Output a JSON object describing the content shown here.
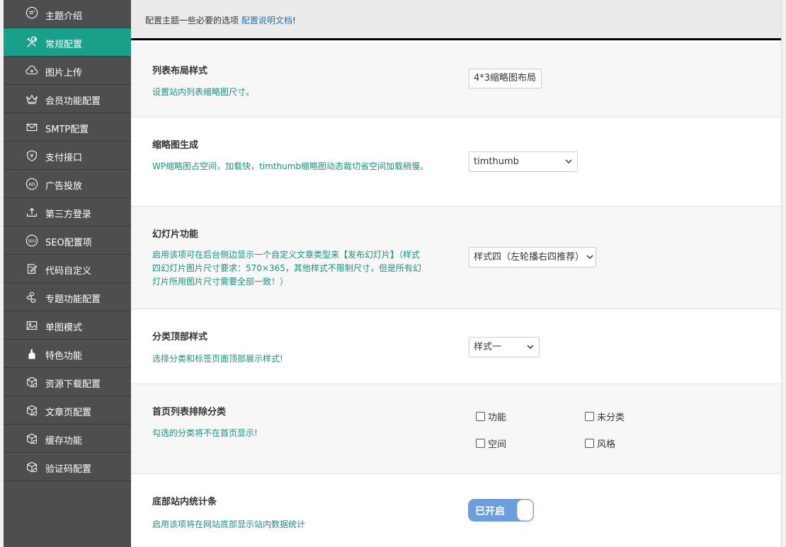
{
  "sidebar": {
    "items": [
      {
        "label": "主题介绍",
        "icon": "speech-bubble-icon"
      },
      {
        "label": "常规配置",
        "icon": "tools-icon",
        "active": true
      },
      {
        "label": "图片上传",
        "icon": "cloud-upload-icon"
      },
      {
        "label": "会员功能配置",
        "icon": "crown-icon"
      },
      {
        "label": "SMTP配置",
        "icon": "mail-icon"
      },
      {
        "label": "支付接口",
        "icon": "yen-shield-icon"
      },
      {
        "label": "广告投放",
        "icon": "ad-icon"
      },
      {
        "label": "第三方登录",
        "icon": "login-upload-icon"
      },
      {
        "label": "SEO配置项",
        "icon": "seo-icon"
      },
      {
        "label": "代码自定义",
        "icon": "code-edit-icon"
      },
      {
        "label": "专题功能配置",
        "icon": "topic-icon"
      },
      {
        "label": "单图模式",
        "icon": "image-icon"
      },
      {
        "label": "特色功能",
        "icon": "thumb-icon"
      },
      {
        "label": "资源下载配置",
        "icon": "box-gear-icon"
      },
      {
        "label": "文章页配置",
        "icon": "box-gear-icon"
      },
      {
        "label": "缓存功能",
        "icon": "box-gear-icon"
      },
      {
        "label": "验证码配置",
        "icon": "box-gear-icon"
      }
    ]
  },
  "header": {
    "text": "配置主题一些必要的选项",
    "link": "配置说明文档",
    "suffix": "!"
  },
  "sections": {
    "list_layout": {
      "title": "列表布局样式",
      "desc": "设置站内列表缩略图尺寸。",
      "value": "4*3缩略图布局"
    },
    "thumb_gen": {
      "title": "缩略图生成",
      "desc": "WP缩略图占空间，加载快，timthumb缩略图动态裁切省空间加载稍慢。",
      "value": "timthumb"
    },
    "slides": {
      "title": "幻灯片功能",
      "desc": "启用该项可在后台侧边显示一个自定义文章类型来【发布幻灯片】（样式四幻灯片图片尺寸要求：570×365，其他样式不限制尺寸，但是所有幻灯片所用图片尺寸需要全部一致！）",
      "value": "样式四（左轮播右四推荐）"
    },
    "cat_header": {
      "title": "分类顶部样式",
      "desc": "选择分类和标签页面顶部展示样式!",
      "value": "样式一"
    },
    "home_exclude": {
      "title": "首页列表排除分类",
      "desc": "勾选的分类将不在首页显示!",
      "options": [
        "功能",
        "未分类",
        "空间",
        "风格"
      ]
    },
    "footer_stats": {
      "title": "底部站内统计条",
      "desc": "启用该项将在网站底部显示站内数据统计",
      "toggle_label": "已开启"
    }
  },
  "colors": {
    "sidebar_bg": "#4e4e4e",
    "active_bg": "#19a08a",
    "desc_text": "#16917e",
    "link": "#1a78c2",
    "toggle_on": "#6a9fdc"
  }
}
